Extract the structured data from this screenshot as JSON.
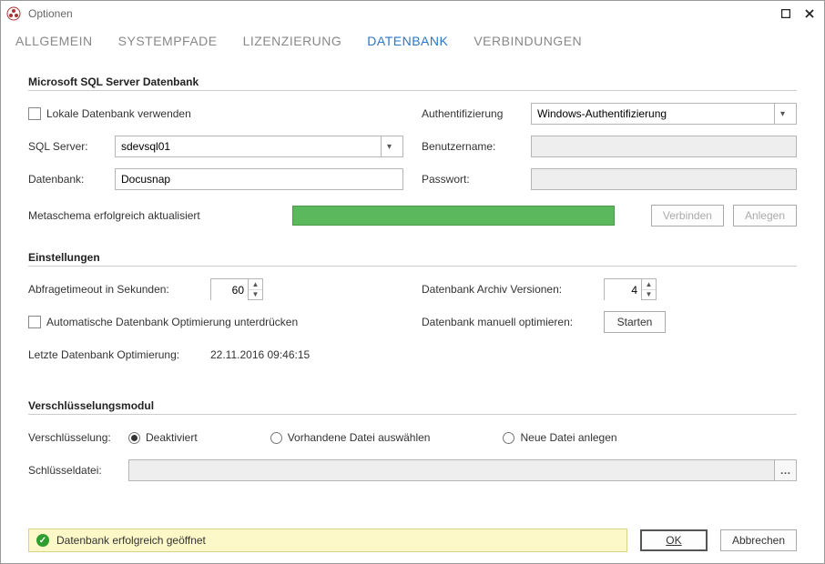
{
  "window": {
    "title": "Optionen"
  },
  "tabs": {
    "items": [
      {
        "label": "ALLGEMEIN"
      },
      {
        "label": "SYSTEMPFADE"
      },
      {
        "label": "LIZENZIERUNG"
      },
      {
        "label": "DATENBANK"
      },
      {
        "label": "VERBINDUNGEN"
      }
    ],
    "activeIndex": 3
  },
  "db": {
    "section_title": "Microsoft SQL Server Datenbank",
    "use_local_label": "Lokale Datenbank verwenden",
    "sql_server_label": "SQL Server:",
    "sql_server_value": "sdevsql01",
    "database_label": "Datenbank:",
    "database_value": "Docusnap",
    "auth_label": "Authentifizierung",
    "auth_value": "Windows-Authentifizierung",
    "user_label": "Benutzername:",
    "user_value": "",
    "pass_label": "Passwort:",
    "pass_value": "",
    "meta_status": "Metaschema erfolgreich aktualisiert",
    "connect_label": "Verbinden",
    "create_label": "Anlegen"
  },
  "settings": {
    "section_title": "Einstellungen",
    "timeout_label": "Abfragetimeout in Sekunden:",
    "timeout_value": "60",
    "archive_label": "Datenbank Archiv Versionen:",
    "archive_value": "4",
    "suppress_opt_label": "Automatische Datenbank Optimierung unterdrücken",
    "manual_opt_label": "Datenbank manuell optimieren:",
    "start_label": "Starten",
    "last_opt_label": "Letzte Datenbank Optimierung:",
    "last_opt_value": "22.11.2016 09:46:15"
  },
  "crypto": {
    "section_title": "Verschlüsselungsmodul",
    "encryption_label": "Verschlüsselung:",
    "opt_deactivated": "Deaktiviert",
    "opt_existing": "Vorhandene Datei auswählen",
    "opt_new": "Neue Datei anlegen",
    "keyfile_label": "Schlüsseldatei:",
    "keyfile_value": ""
  },
  "footer": {
    "status_text": "Datenbank erfolgreich geöffnet",
    "ok_label": "OK",
    "cancel_label": "Abbrechen"
  }
}
